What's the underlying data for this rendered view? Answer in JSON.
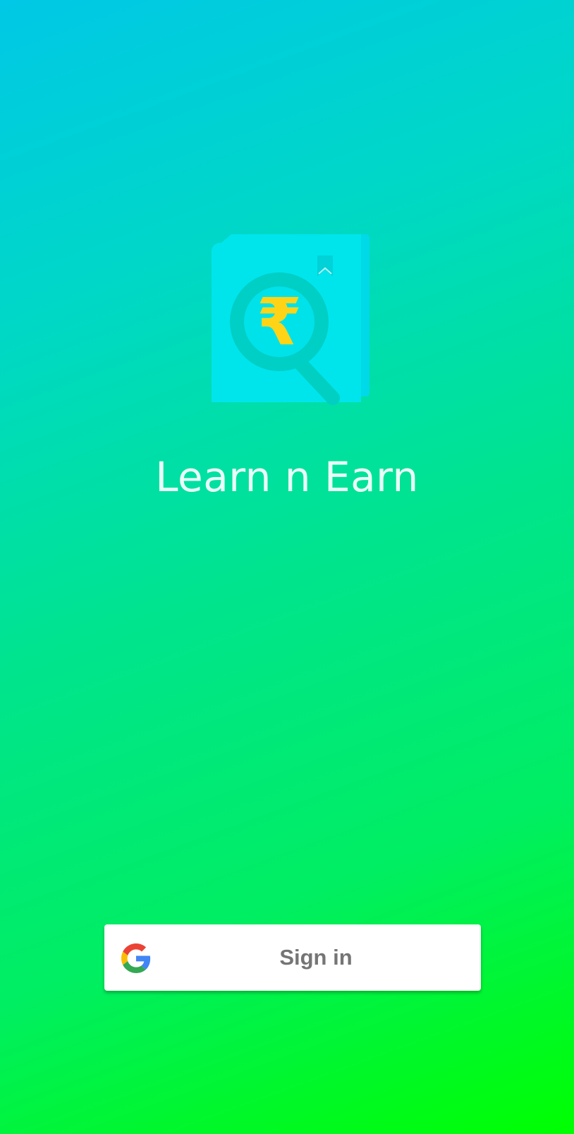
{
  "app": {
    "title": "Learn n Earn"
  },
  "logo": {
    "icon": "book-magnifier-rupee-icon",
    "glyph": "₹",
    "colors": {
      "book": "#00e5ec",
      "book_edge": "#00d6e6",
      "lens_ring": "#00cfc6",
      "lens_fill": "#00e2ea",
      "rupee": "#ffd417"
    }
  },
  "signin": {
    "label": "Sign in",
    "icon": "google-g-icon"
  },
  "colors": {
    "gradient_top": "#00c8e6",
    "gradient_bottom": "#00ff00",
    "button_bg": "#ffffff",
    "button_text": "#757575"
  }
}
